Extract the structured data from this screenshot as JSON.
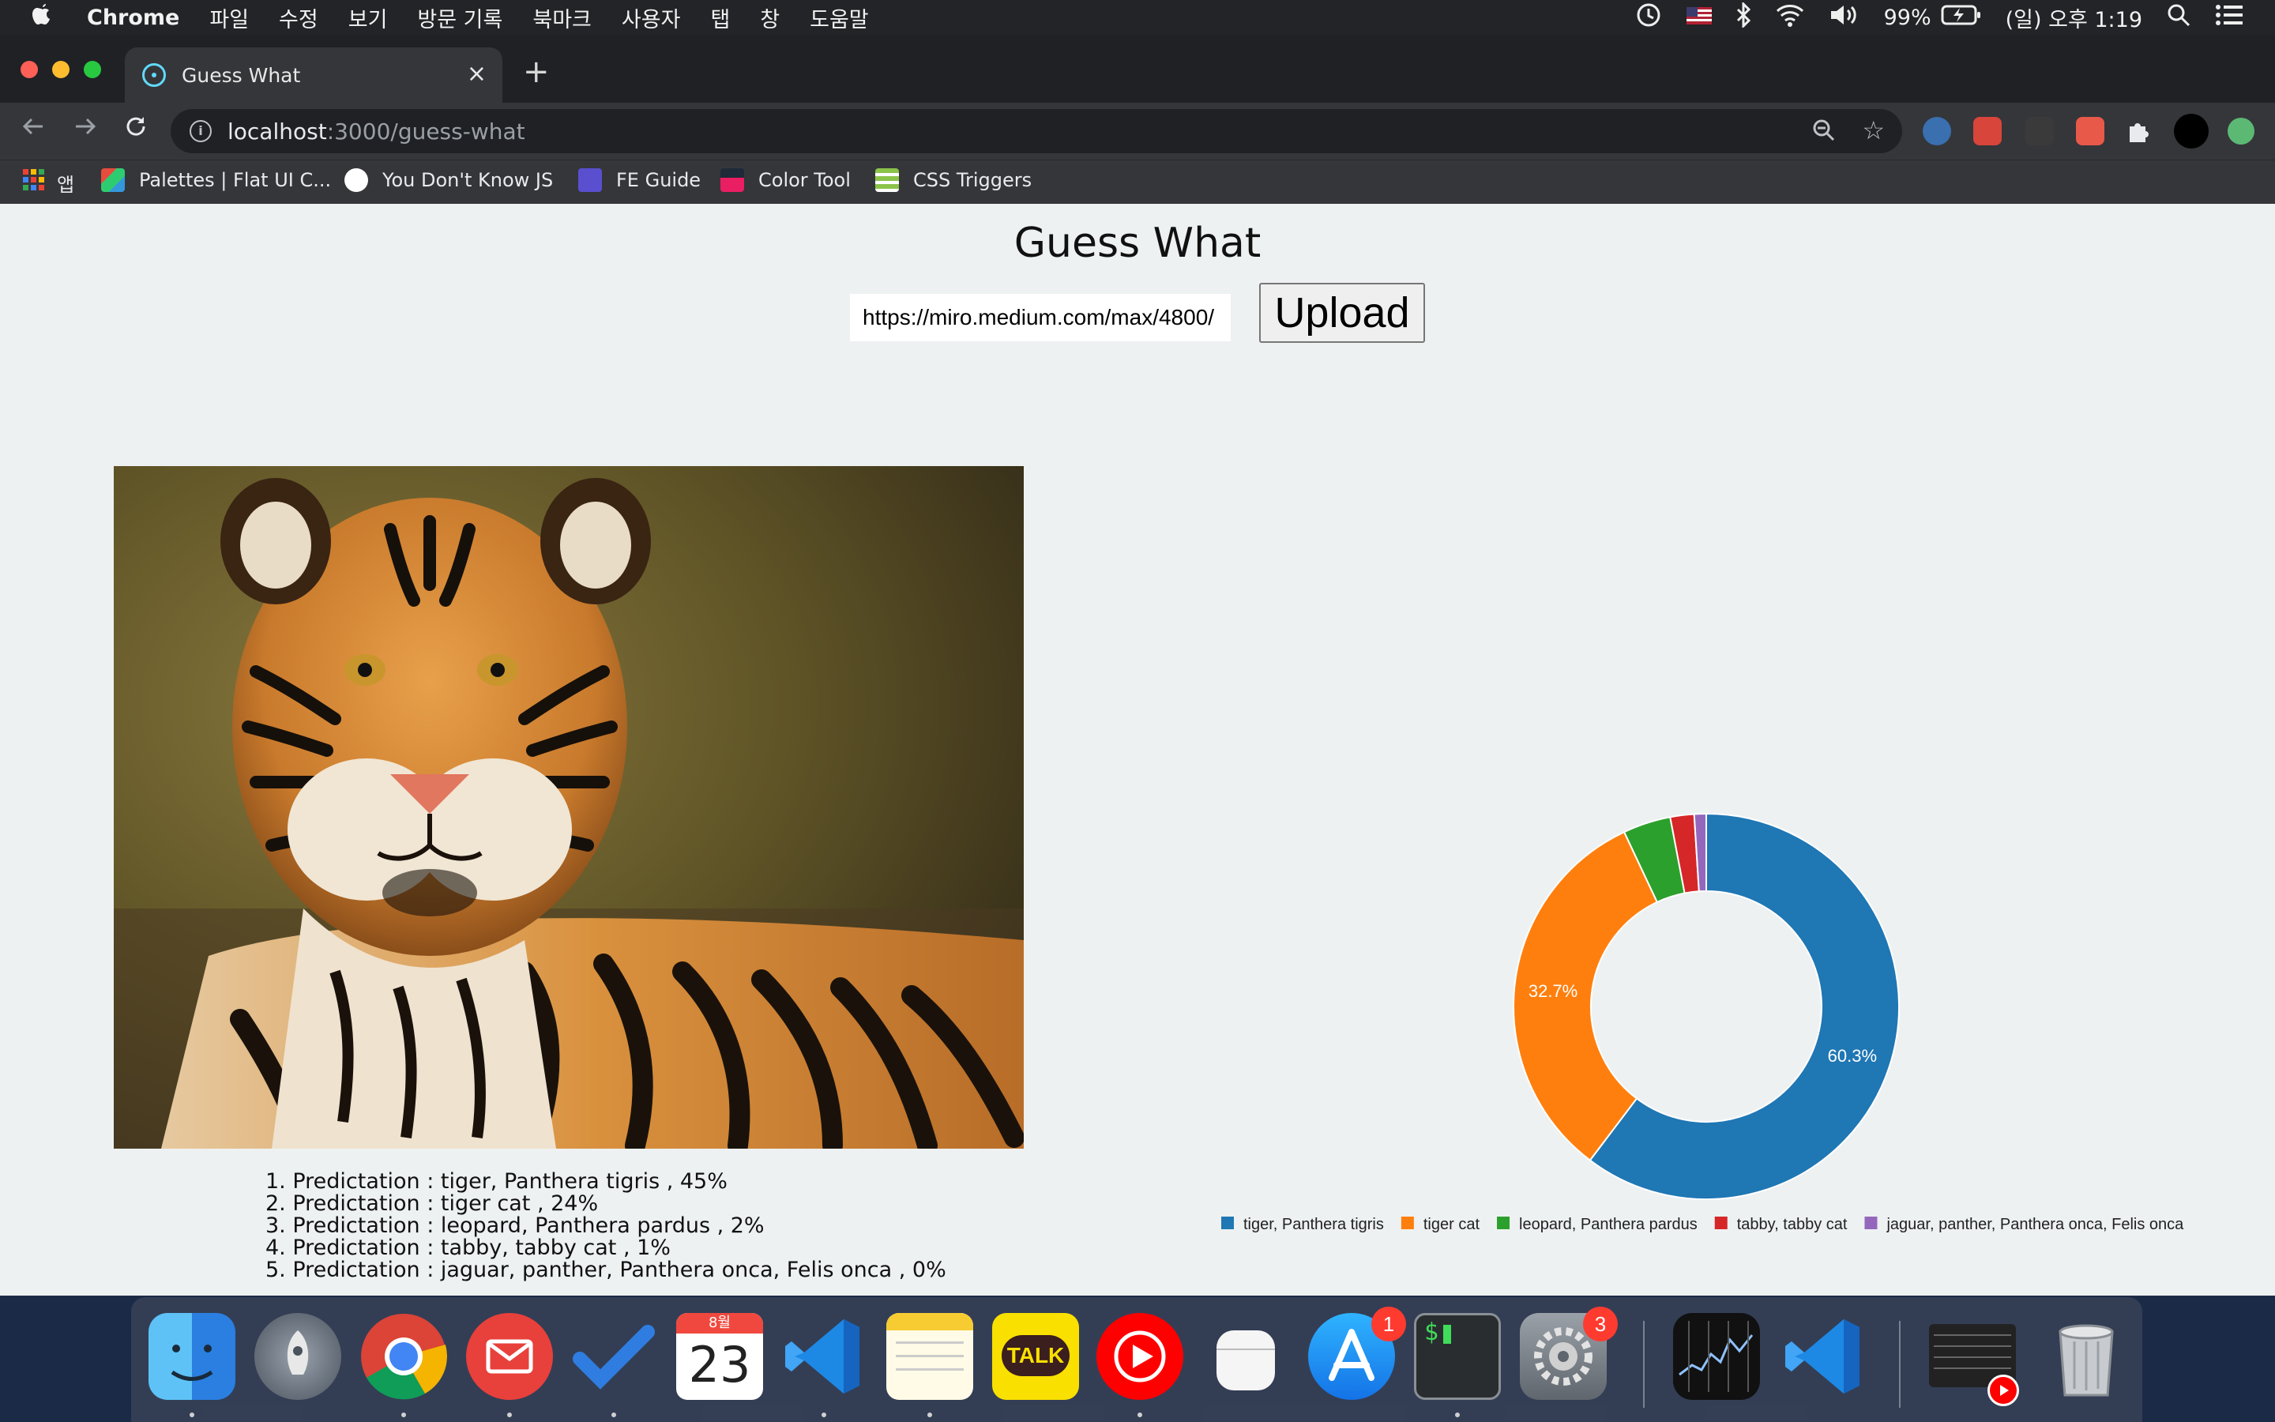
{
  "menubar": {
    "app_name": "Chrome",
    "menus": [
      "파일",
      "수정",
      "보기",
      "방문 기록",
      "북마크",
      "사용자",
      "탭",
      "창",
      "도움말"
    ],
    "battery": "99%",
    "clock": "(일) 오후 1:19"
  },
  "tab": {
    "title": "Guess What",
    "close": "×",
    "new_tab": "+"
  },
  "address": {
    "host": "localhost",
    "path": ":3000/guess-what"
  },
  "bookmarks": [
    {
      "label": "앱",
      "icon": "apps-grid-icon"
    },
    {
      "label": "Palettes | Flat UI C...",
      "icon": "flatui-icon"
    },
    {
      "label": "You Don't Know JS",
      "icon": "github-icon"
    },
    {
      "label": "FE Guide",
      "icon": "ui-icon"
    },
    {
      "label": "Color Tool",
      "icon": "color-tool-icon"
    },
    {
      "label": "CSS Triggers",
      "icon": "css-triggers-icon"
    }
  ],
  "page": {
    "title": "Guess What",
    "url_input_value": "https://miro.medium.com/max/4800/",
    "upload_label": "Upload",
    "image_subject": "tiger photo",
    "predictions": [
      "1. Predictation : tiger, Panthera tigris , 45%",
      "2. Predictation : tiger cat , 24%",
      "3. Predictation : leopard, Panthera pardus , 2%",
      "4. Predictation : tabby, tabby cat , 1%",
      "5. Predictation : jaguar, panther, Panthera onca, Felis onca , 0%"
    ]
  },
  "chart_data": {
    "type": "pie",
    "donut": true,
    "categories": [
      "tiger, Panthera tigris",
      "tiger cat",
      "leopard, Panthera pardus",
      "tabby, tabby cat",
      "jaguar, panther, Panthera onca, Felis onca"
    ],
    "values": [
      60.3,
      32.7,
      4.0,
      2.0,
      1.0
    ],
    "data_labels": [
      "60.3%",
      "32.7%",
      "",
      "",
      ""
    ],
    "colors": [
      "#1f77b4",
      "#ff7f0e",
      "#2ca02c",
      "#d62728",
      "#9467bd"
    ],
    "legend_position": "bottom"
  },
  "dock": {
    "apps": [
      "finder-icon",
      "launchpad-icon",
      "chrome-icon",
      "mail-icon",
      "todo-icon",
      "calendar-icon",
      "vscode-icon",
      "notes-icon",
      "kakaotalk-icon",
      "youtube-music-icon",
      "airpods-icon",
      "app-store-icon",
      "terminal-icon",
      "system-preferences-icon",
      "stocks-icon",
      "vscode-icon",
      "screenshot-icon",
      "trash-icon"
    ],
    "calendar_month": "8월",
    "calendar_day": "23",
    "kakao_label": "TALK",
    "app_store_badge": "1",
    "sys_prefs_badge": "3",
    "terminal_prompt": "$"
  }
}
